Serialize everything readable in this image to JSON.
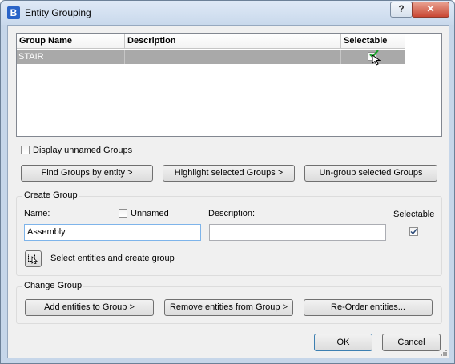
{
  "window": {
    "title": "Entity Grouping",
    "help_label": "?",
    "close_label": "✕",
    "app_icon_label": "B"
  },
  "list": {
    "columns": [
      "Group Name",
      "Description",
      "Selectable"
    ],
    "rows": [
      {
        "name": "STAIR",
        "description": "",
        "selectable": true
      }
    ]
  },
  "display_unnamed": {
    "label": "Display unnamed Groups",
    "checked": false
  },
  "actions": {
    "find": "Find Groups by entity >",
    "highlight": "Highlight selected Groups >",
    "ungroup": "Un-group selected Groups"
  },
  "create_group": {
    "title": "Create Group",
    "name_label": "Name:",
    "unnamed_label": "Unnamed",
    "unnamed_checked": false,
    "name_value": "Assembly",
    "description_label": "Description:",
    "description_value": "",
    "selectable_label": "Selectable",
    "selectable_checked": true,
    "select_entities_label": "Select entities and create group"
  },
  "change_group": {
    "title": "Change Group",
    "add": "Add entities to Group >",
    "remove": "Remove entities from Group >",
    "reorder": "Re-Order entities..."
  },
  "footer": {
    "ok": "OK",
    "cancel": "Cancel"
  }
}
